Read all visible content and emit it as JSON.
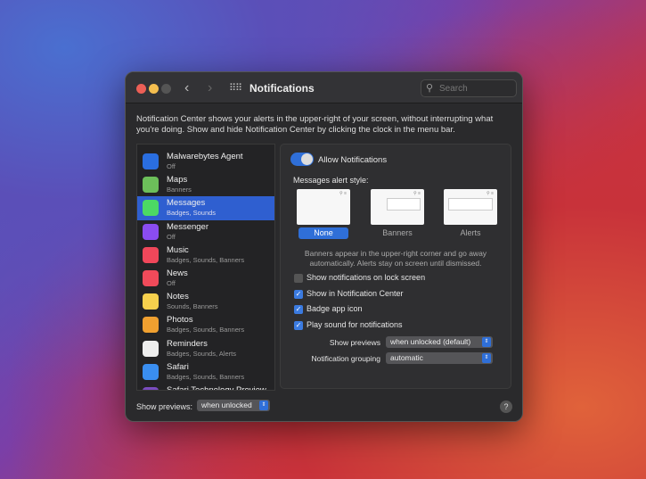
{
  "window": {
    "title": "Notifications",
    "search_placeholder": "Search",
    "description": "Notification Center shows your alerts in the upper-right of your screen, without interrupting what you're doing. Show and hide Notification Center by clicking the clock in the menu bar."
  },
  "apps": [
    {
      "name": "Malwarebytes Agent",
      "status": "Off",
      "icon": "malwarebytes-icon",
      "color": "#2a6ee0"
    },
    {
      "name": "Maps",
      "status": "Banners",
      "icon": "maps-icon",
      "color": "#6cbf5a"
    },
    {
      "name": "Messages",
      "status": "Badges, Sounds",
      "icon": "messages-icon",
      "color": "#4cd964",
      "selected": true
    },
    {
      "name": "Messenger",
      "status": "Off",
      "icon": "messenger-icon",
      "color": "#8a4cf0"
    },
    {
      "name": "Music",
      "status": "Badges, Sounds, Banners",
      "icon": "music-icon",
      "color": "#f0475a"
    },
    {
      "name": "News",
      "status": "Off",
      "icon": "news-icon",
      "color": "#f04a5a"
    },
    {
      "name": "Notes",
      "status": "Sounds, Banners",
      "icon": "notes-icon",
      "color": "#f6d04d"
    },
    {
      "name": "Photos",
      "status": "Badges, Sounds, Banners",
      "icon": "photos-icon",
      "color": "#f0a030"
    },
    {
      "name": "Reminders",
      "status": "Badges, Sounds, Alerts",
      "icon": "reminders-icon",
      "color": "#eeeeee"
    },
    {
      "name": "Safari",
      "status": "Badges, Sounds, Banners",
      "icon": "safari-icon",
      "color": "#3a8ef0"
    },
    {
      "name": "Safari Technology Preview",
      "status": "",
      "icon": "safari-preview-icon",
      "color": "#7a4cc0"
    }
  ],
  "settings": {
    "allow_label": "Allow Notifications",
    "alert_style_label": "Messages alert style:",
    "styles": [
      "None",
      "Banners",
      "Alerts"
    ],
    "selected_style": "None",
    "style_help": "Banners appear in the upper-right corner and go away automatically. Alerts stay on screen until dismissed.",
    "checks": [
      {
        "label": "Show notifications on lock screen",
        "checked": false
      },
      {
        "label": "Show in Notification Center",
        "checked": true
      },
      {
        "label": "Badge app icon",
        "checked": true
      },
      {
        "label": "Play sound for notifications",
        "checked": true
      }
    ],
    "previews_label": "Show previews",
    "previews_value": "when unlocked (default)",
    "grouping_label": "Notification grouping",
    "grouping_value": "automatic"
  },
  "footer": {
    "show_previews_label": "Show previews:",
    "show_previews_value": "when unlocked",
    "help": "?"
  }
}
